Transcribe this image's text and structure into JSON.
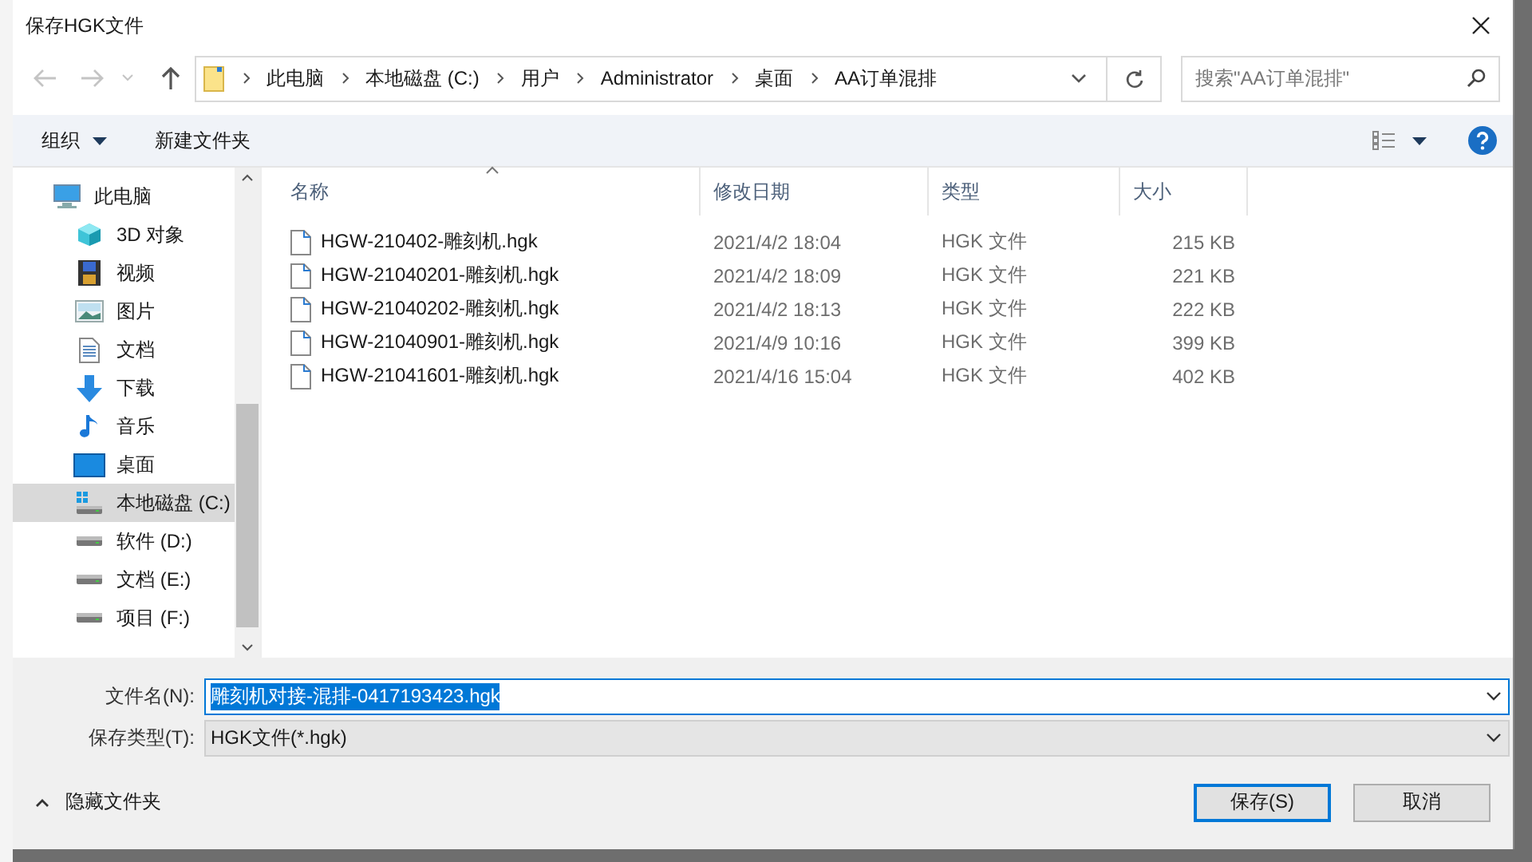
{
  "window": {
    "title": "保存HGK文件"
  },
  "address": {
    "segments": [
      "此电脑",
      "本地磁盘 (C:)",
      "用户",
      "Administrator",
      "桌面",
      "AA订单混排"
    ]
  },
  "search": {
    "placeholder": "搜索\"AA订单混排\""
  },
  "toolbar": {
    "organize": "组织",
    "new_folder": "新建文件夹"
  },
  "sidebar": {
    "items": [
      {
        "label": "此电脑",
        "kind": "pc",
        "selected": false,
        "children": [
          {
            "label": "3D 对象",
            "kind": "cube",
            "selected": false
          },
          {
            "label": "视频",
            "kind": "film",
            "selected": false
          },
          {
            "label": "图片",
            "kind": "image",
            "selected": false
          },
          {
            "label": "文档",
            "kind": "doc",
            "selected": false
          },
          {
            "label": "下载",
            "kind": "down",
            "selected": false
          },
          {
            "label": "音乐",
            "kind": "note",
            "selected": false
          },
          {
            "label": "桌面",
            "kind": "desk",
            "selected": false
          },
          {
            "label": "本地磁盘 (C:)",
            "kind": "sysdrive",
            "selected": true
          },
          {
            "label": "软件 (D:)",
            "kind": "drive",
            "selected": false
          },
          {
            "label": "文档 (E:)",
            "kind": "drive",
            "selected": false
          },
          {
            "label": "项目 (F:)",
            "kind": "drive",
            "selected": false
          }
        ]
      }
    ]
  },
  "table": {
    "columns": [
      {
        "label": "名称",
        "sorted": true
      },
      {
        "label": "修改日期",
        "sorted": false
      },
      {
        "label": "类型",
        "sorted": false
      },
      {
        "label": "大小",
        "sorted": false
      }
    ],
    "rows": [
      {
        "name": "HGW-210402-雕刻机.hgk",
        "date": "2021/4/2 18:04",
        "type": "HGK 文件",
        "size": "215 KB"
      },
      {
        "name": "HGW-21040201-雕刻机.hgk",
        "date": "2021/4/2 18:09",
        "type": "HGK 文件",
        "size": "221 KB"
      },
      {
        "name": "HGW-21040202-雕刻机.hgk",
        "date": "2021/4/2 18:13",
        "type": "HGK 文件",
        "size": "222 KB"
      },
      {
        "name": "HGW-21040901-雕刻机.hgk",
        "date": "2021/4/9 10:16",
        "type": "HGK 文件",
        "size": "399 KB"
      },
      {
        "name": "HGW-21041601-雕刻机.hgk",
        "date": "2021/4/16 15:04",
        "type": "HGK 文件",
        "size": "402 KB"
      }
    ]
  },
  "form": {
    "file_name_label": "文件名(N):",
    "file_name": "雕刻机对接-混排-0417193423.hgk",
    "file_type_label": "保存类型(T):",
    "file_type": "HGK文件(*.hgk)"
  },
  "hide_folders": "隐藏文件夹",
  "buttons": [
    {
      "label": "保存(S)",
      "kind": "primary"
    },
    {
      "label": "取消",
      "kind": "normal"
    }
  ]
}
